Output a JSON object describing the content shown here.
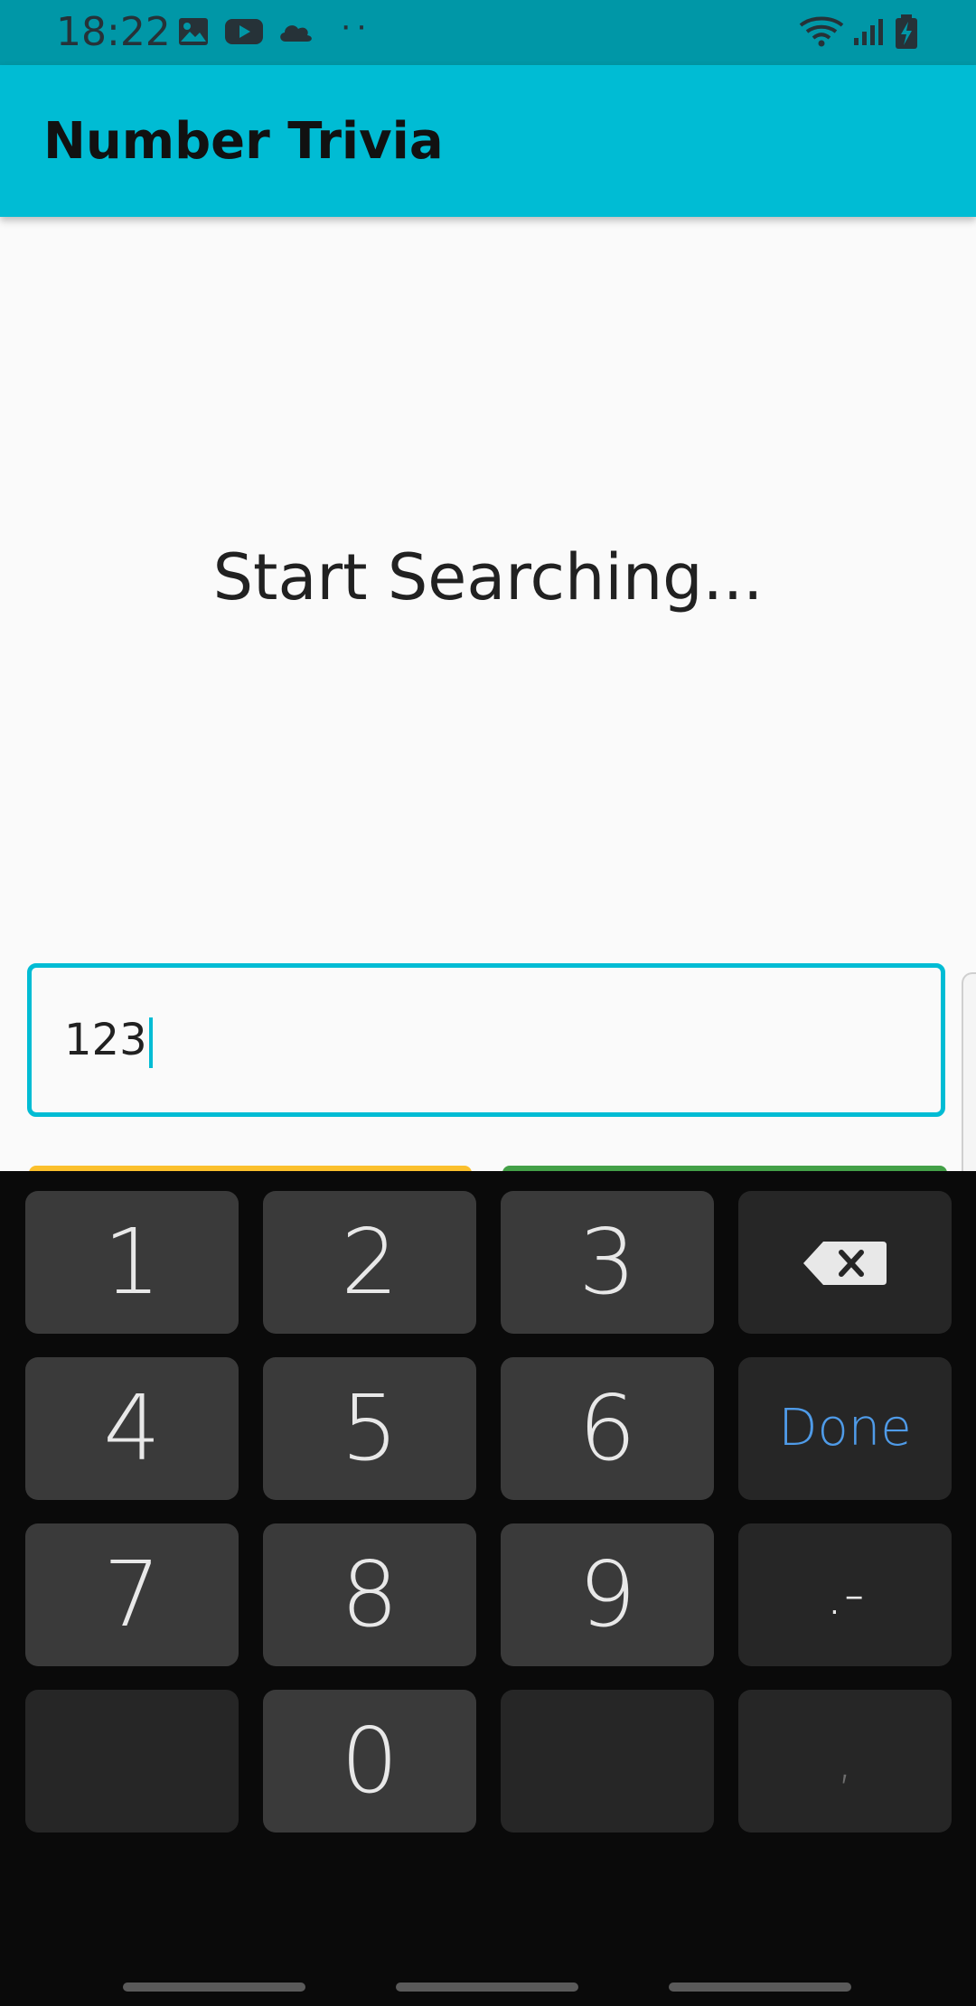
{
  "status_bar": {
    "time": "18:22",
    "left_icons": [
      "image-icon",
      "youtube-icon",
      "cloud-icon",
      "more-notifications-icon"
    ],
    "right_icons": [
      "wifi-icon",
      "signal-icon",
      "battery-charging-icon"
    ],
    "dots": "··"
  },
  "app_bar": {
    "title": "Number Trivia"
  },
  "content": {
    "message": "Start Searching...",
    "input_value": "123"
  },
  "keyboard": {
    "rows": [
      [
        "1",
        "2",
        "3",
        "backspace"
      ],
      [
        "4",
        "5",
        "6",
        "Done"
      ],
      [
        "7",
        "8",
        "9",
        ".-"
      ],
      [
        "",
        "0",
        "",
        ","
      ]
    ],
    "done_label": "Done",
    "done_color": "#4f9be8"
  },
  "colors": {
    "accent": "#00bcd4",
    "status_bar": "#0097a7",
    "button_yellow": "#fbc02d",
    "button_green": "#43a047"
  }
}
